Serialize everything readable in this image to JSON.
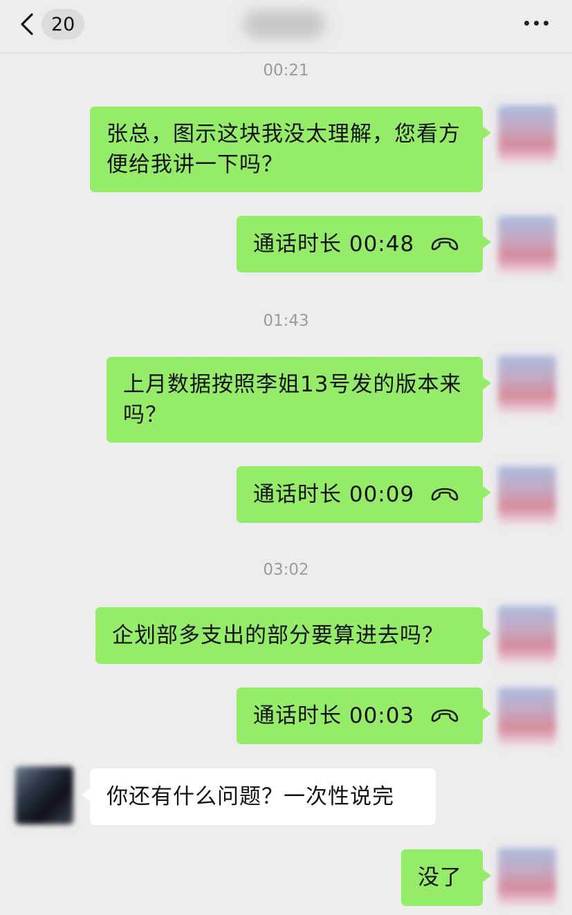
{
  "header": {
    "unread_count": "20"
  },
  "messages": [
    {
      "type": "timestamp",
      "text": "00:21"
    },
    {
      "type": "text",
      "from": "self",
      "text": "张总，图示这块我没太理解，您看方便给我讲一下吗？"
    },
    {
      "type": "call",
      "from": "self",
      "text": "通话时长 00:48",
      "icon": "phone-hangup-icon"
    },
    {
      "type": "timestamp",
      "text": "01:43"
    },
    {
      "type": "text",
      "from": "self",
      "text": "上月数据按照李姐13号发的版本来吗？"
    },
    {
      "type": "call",
      "from": "self",
      "text": "通话时长 00:09",
      "icon": "phone-hangup-icon"
    },
    {
      "type": "timestamp",
      "text": "03:02"
    },
    {
      "type": "text",
      "from": "self",
      "text": "企划部多支出的部分要算进去吗？"
    },
    {
      "type": "call",
      "from": "self",
      "text": "通话时长 00:03",
      "icon": "phone-hangup-icon"
    },
    {
      "type": "text",
      "from": "other",
      "text": "你还有什么问题？一次性说完"
    },
    {
      "type": "text",
      "from": "self",
      "text": "没了"
    }
  ],
  "colors": {
    "self_bubble": "#95ec69",
    "other_bubble": "#ffffff",
    "background": "#ededed",
    "timestamp_text": "#9b9b9b"
  }
}
